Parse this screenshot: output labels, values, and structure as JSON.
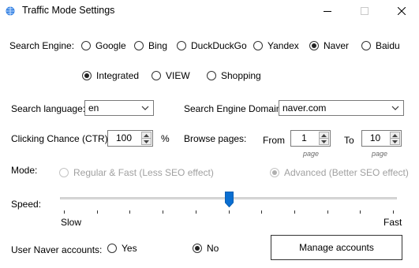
{
  "window": {
    "title": "Traffic Mode Settings"
  },
  "search_engine": {
    "label": "Search Engine:",
    "options": [
      "Google",
      "Bing",
      "DuckDuckGo",
      "Yandex",
      "Naver",
      "Baidu"
    ],
    "selected": "Naver"
  },
  "naver_mode": {
    "options": [
      "Integrated",
      "VIEW",
      "Shopping"
    ],
    "selected": "Integrated"
  },
  "search_language": {
    "label": "Search language:",
    "value": "en"
  },
  "search_engine_domain": {
    "label": "Search Engine Domain:",
    "value": "naver.com"
  },
  "clicking_chance": {
    "label": "Clicking Chance (CTR):",
    "value": "100",
    "unit": "%"
  },
  "browse_pages": {
    "label": "Browse pages:",
    "from_label": "From",
    "from_value": "1",
    "to_label": "To",
    "to_value": "10",
    "page_caption": "page"
  },
  "mode": {
    "label": "Mode:",
    "options": [
      "Regular & Fast (Less SEO effect)",
      "Advanced (Better SEO effect)"
    ],
    "selected": "Advanced (Better SEO effect)",
    "disabled": true
  },
  "speed": {
    "label": "Speed:",
    "min_label": "Slow",
    "max_label": "Fast",
    "level": 0.5
  },
  "accounts": {
    "label": "User Naver accounts:",
    "options": [
      "Yes",
      "No"
    ],
    "selected": "No",
    "manage_label": "Manage accounts"
  }
}
